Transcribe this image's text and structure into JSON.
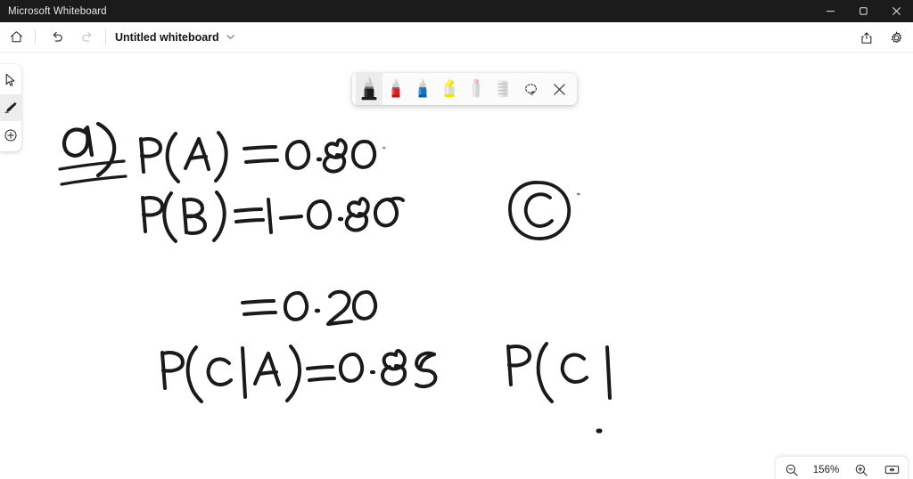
{
  "window": {
    "title": "Microsoft Whiteboard",
    "controls": {
      "minimize_label": "Minimize",
      "maximize_label": "Restore",
      "close_label": "Close"
    }
  },
  "app_toolbar": {
    "home_label": "Home",
    "undo_label": "Undo",
    "redo_label": "Redo",
    "document_title": "Untitled whiteboard",
    "title_chevron": "chevron-down",
    "share_label": "Share",
    "settings_label": "Settings"
  },
  "left_rail": {
    "items": [
      {
        "id": "select",
        "label": "Select",
        "icon": "cursor-arrow-icon",
        "active": false
      },
      {
        "id": "pen",
        "label": "Inking",
        "icon": "pen-icon",
        "active": true
      },
      {
        "id": "create",
        "label": "Create",
        "icon": "plus-circle-icon",
        "active": false
      }
    ]
  },
  "pen_toolbar": {
    "pens": [
      {
        "id": "pen-black",
        "label": "Black pen",
        "color": "#1a1a1a",
        "type": "pen",
        "selected": true
      },
      {
        "id": "pen-red",
        "label": "Red pen",
        "color": "#d62222",
        "type": "pen",
        "selected": false
      },
      {
        "id": "pen-blue",
        "label": "Blue pen",
        "color": "#1072c6",
        "type": "pen",
        "selected": false
      },
      {
        "id": "pen-yellow",
        "label": "Yellow highlighter",
        "color": "#f2e300",
        "type": "highlighter",
        "selected": false
      },
      {
        "id": "eraser",
        "label": "Eraser",
        "color": "#f4a8bf",
        "type": "eraser",
        "selected": false
      },
      {
        "id": "ruler",
        "label": "Ruler",
        "color": "#d7d7d7",
        "type": "ruler",
        "selected": false
      }
    ],
    "lasso_label": "Lasso select",
    "close_label": "Close inking toolbar"
  },
  "zoom_controls": {
    "zoom_out_label": "Zoom out",
    "zoom_level": "156%",
    "zoom_in_label": "Zoom in",
    "fit_label": "Fit to screen"
  },
  "canvas": {
    "background_color": "#ffffff",
    "ink_color": "#1a1a1a",
    "notes": [
      {
        "id": "marker-a",
        "text": "a)",
        "underlined": true
      },
      {
        "id": "line-pa",
        "text": "P(A) = 0.80"
      },
      {
        "id": "line-pb",
        "text": "P(B) = 1 - 0.80"
      },
      {
        "id": "line-pb2",
        "text": "= 0.20"
      },
      {
        "id": "line-pca",
        "text": "P(C|A) = 0.85"
      },
      {
        "id": "marker-c",
        "text": "C",
        "circled": true
      },
      {
        "id": "line-pc",
        "text": "P(C|"
      },
      {
        "id": "stray-dot",
        "text": "."
      }
    ]
  }
}
